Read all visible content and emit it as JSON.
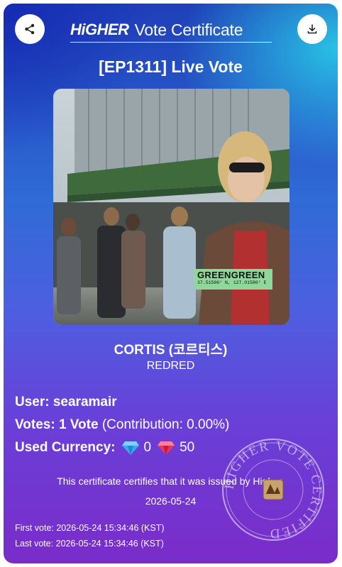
{
  "header": {
    "brand_logo": "HiGHER",
    "brand_title": "Vote Certificate",
    "share_icon": "share-icon",
    "download_icon": "download-icon"
  },
  "episode_title": "[EP1311] Live Vote",
  "photo": {
    "tag_title": "GREENGREEN",
    "tag_coords": "37.51506° N, 127.01580° E"
  },
  "artist": "CORTIS (코르티스)",
  "song": "REDRED",
  "user": {
    "label": "User:",
    "value": "searamair"
  },
  "votes": {
    "label": "Votes:",
    "value": "1 Vote",
    "contribution": "(Contribution: 0.00%)"
  },
  "currency": {
    "label": "Used Currency:",
    "diamond_blue_icon": "blue-diamond-icon",
    "blue_amount": "0",
    "diamond_red_icon": "red-diamond-icon",
    "red_amount": "50"
  },
  "certify_text": "This certificate certifies that it was issued by Higher.",
  "issue_date": "2026-05-24",
  "first_vote": "First vote: 2026-05-24 15:34:46 (KST)",
  "last_vote": "Last vote: 2026-05-24 15:34:46 (KST)",
  "seal": {
    "text": "HIGHER VOTE CERTIFIED",
    "icon": "certified-seal-icon"
  },
  "colors": {
    "gradient_top": "#1f3fb8",
    "gradient_cyan": "#28c8e6",
    "gradient_bottom": "#7a2cc8",
    "tag_green": "#8fd79a"
  }
}
